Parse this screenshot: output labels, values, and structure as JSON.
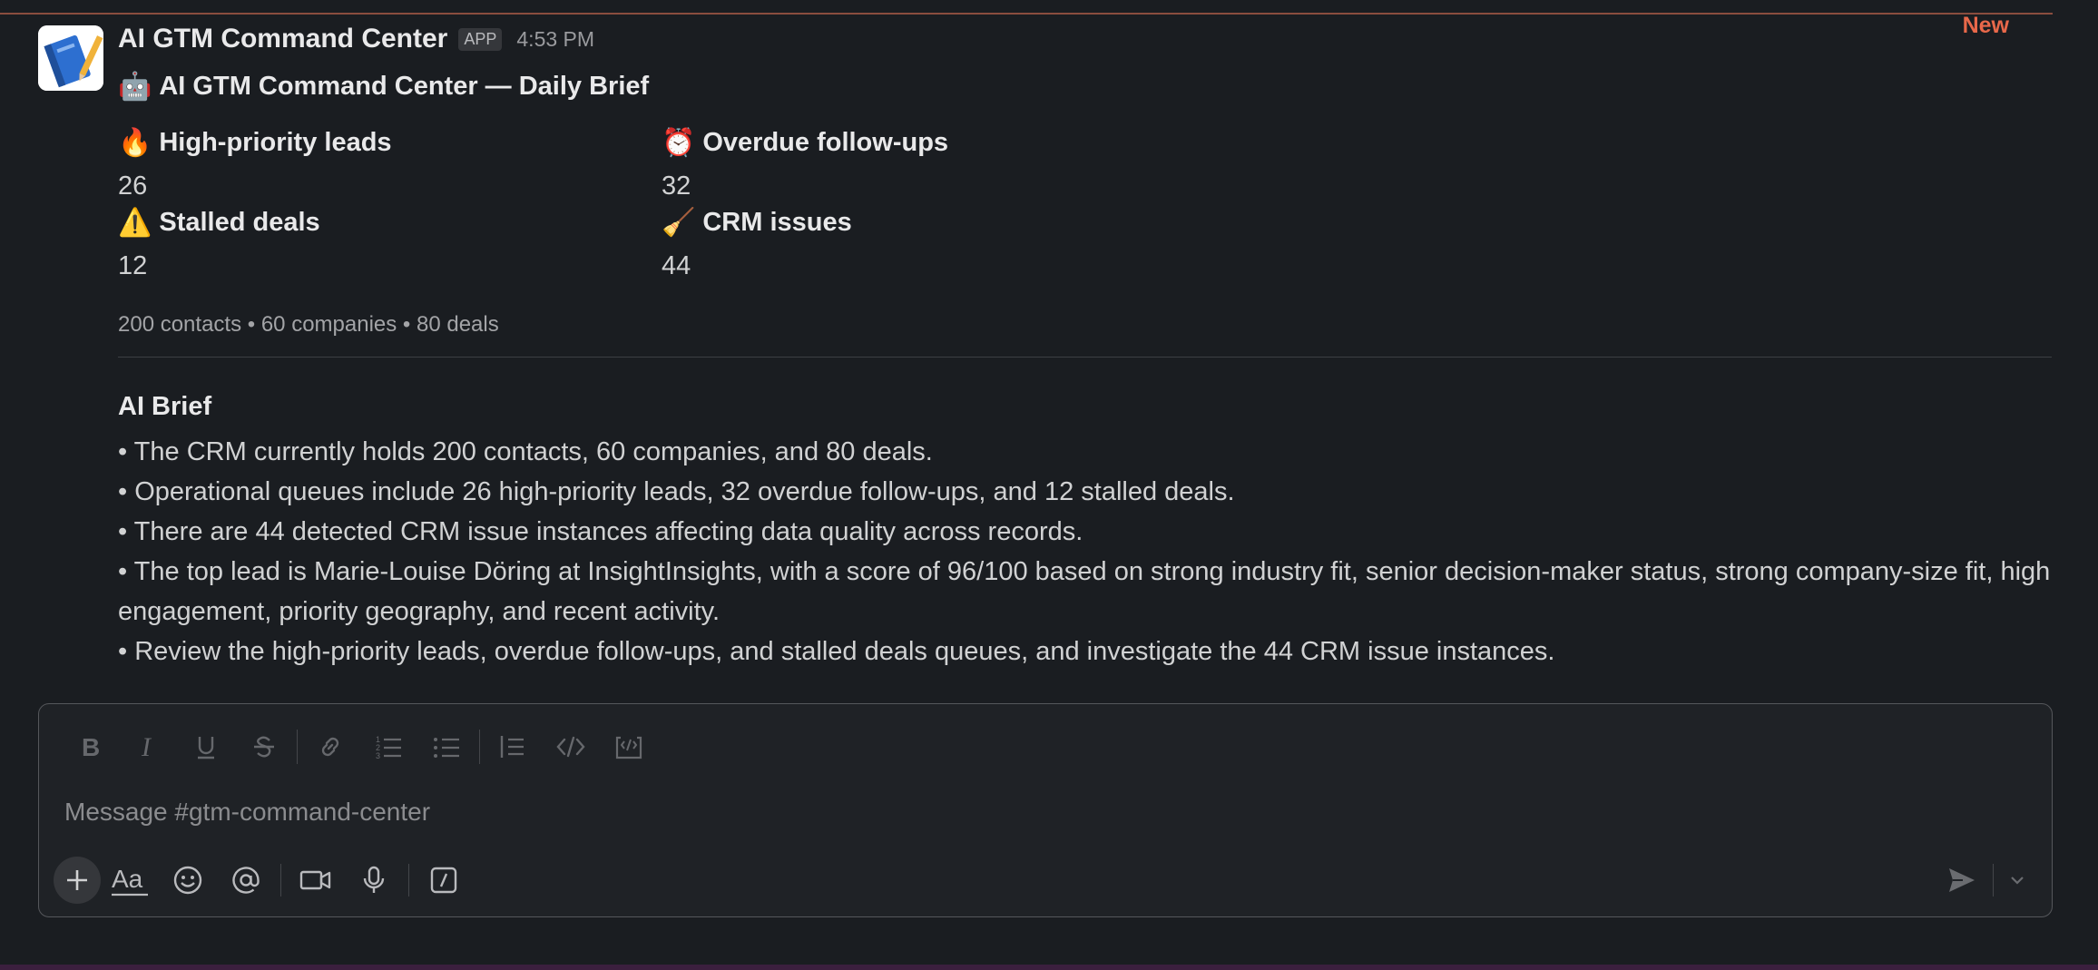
{
  "divider": {
    "new_label": "New"
  },
  "message": {
    "sender": "AI GTM Command Center",
    "badge": "APP",
    "time": "4:53 PM",
    "title": "AI GTM Command Center — Daily Brief",
    "title_emoji": "🤖",
    "stats": [
      {
        "emoji": "🔥",
        "label": "High-priority leads",
        "value": "26"
      },
      {
        "emoji": "⏰",
        "label": "Overdue follow-ups",
        "value": "32"
      },
      {
        "emoji": "⚠️",
        "label": "Stalled deals",
        "value": "12"
      },
      {
        "emoji": "🧹",
        "label": "CRM issues",
        "value": "44"
      }
    ],
    "summary": "200 contacts • 60 companies • 80 deals",
    "ai_heading": "AI Brief",
    "bullets": [
      "• The CRM currently holds 200 contacts, 60 companies, and 80 deals.",
      "• Operational queues include 26 high-priority leads, 32 overdue follow-ups, and 12 stalled deals.",
      "• There are 44 detected CRM issue instances affecting data quality across records.",
      "• The top lead is Marie-Louise Döring at InsightInsights, with a score of 96/100 based on strong industry fit, senior decision-maker status, strong company-size fit, high engagement, priority geography, and recent activity.",
      "• Review the high-priority leads, overdue follow-ups, and stalled deals queues, and investigate the 44 CRM issue instances."
    ]
  },
  "composer": {
    "placeholder": "Message #gtm-command-center",
    "format_icons": [
      "bold-icon",
      "italic-icon",
      "underline-icon",
      "strikethrough-icon",
      "link-icon",
      "ordered-list-icon",
      "bullet-list-icon",
      "blockquote-icon",
      "code-icon",
      "code-block-icon"
    ],
    "tool_icons": [
      "plus-icon",
      "formatting-aa-icon",
      "emoji-icon",
      "mention-icon",
      "video-icon",
      "microphone-icon",
      "slash-command-icon",
      "send-icon",
      "chevron-down-icon"
    ]
  }
}
